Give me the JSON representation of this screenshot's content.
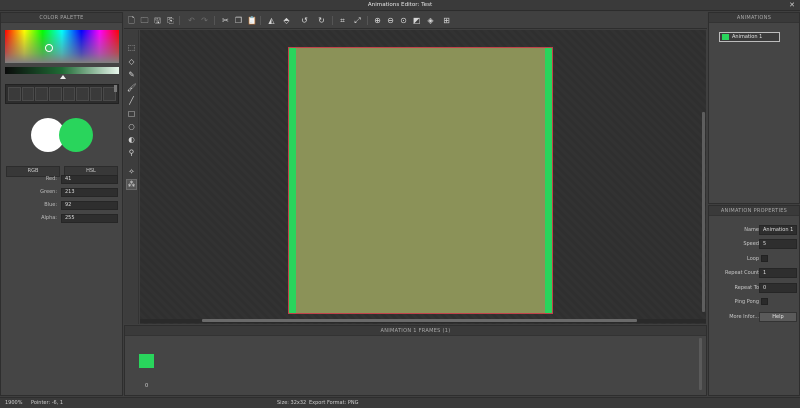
{
  "window": {
    "title": "Animations Editor: Test",
    "close_glyph": "✕"
  },
  "palette": {
    "header": "COLOR PALETTE",
    "primary_color": "#29d55c",
    "secondary_color": "#ffffff",
    "modes": [
      "RGB",
      "HSL"
    ],
    "fields": [
      {
        "label": "Red:",
        "value": "41"
      },
      {
        "label": "Green:",
        "value": "213"
      },
      {
        "label": "Blue:",
        "value": "92"
      },
      {
        "label": "Alpha:",
        "value": "255"
      }
    ]
  },
  "toolbar": {
    "icons": [
      "new-file-icon",
      "open-icon",
      "save-icon",
      "save-as-icon",
      "undo-icon",
      "redo-icon",
      "cut-icon",
      "copy-icon",
      "paste-icon",
      "flip-horizontal-icon",
      "flip-vertical-icon",
      "rotate-left-icon",
      "rotate-right-icon",
      "crop-icon",
      "resize-icon",
      "zoom-in-icon",
      "zoom-out-icon",
      "zoom-fit-icon",
      "background-icon",
      "layers-icon",
      "grid-icon"
    ]
  },
  "tools": [
    "select-icon",
    "eraser-icon",
    "pencil-icon",
    "brush-icon",
    "line-icon",
    "rectangle-icon",
    "ellipse-icon",
    "fill-icon",
    "eyedropper-icon",
    "magic-wand-icon",
    "pattern-icon"
  ],
  "canvas": {
    "sprite_fill": "#8b9258",
    "edge_color": "#29d55c",
    "border_color": "#c0434a"
  },
  "frames": {
    "header": "ANIMATION 1 FRAMES (1)",
    "items": [
      {
        "index": "0",
        "color": "#29d55c"
      }
    ]
  },
  "animations": {
    "header": "ANIMATIONS",
    "items": [
      {
        "name": "Animation 1"
      }
    ]
  },
  "properties": {
    "header": "ANIMATION PROPERTIES",
    "name_label": "Name",
    "name_value": "Animation 1",
    "speed_label": "Speed",
    "speed_value": "5",
    "loop_label": "Loop",
    "repeat_count_label": "Repeat Count",
    "repeat_count_value": "1",
    "repeat_to_label": "Repeat To",
    "repeat_to_value": "0",
    "ping_pong_label": "Ping Pong",
    "more_info_label": "More Infor...",
    "help_label": "Help"
  },
  "status": {
    "zoom": "1900%",
    "pointer": "Pointer: -6, 1",
    "size": "Size: 32x32",
    "export_format": "Export Format: PNG"
  }
}
